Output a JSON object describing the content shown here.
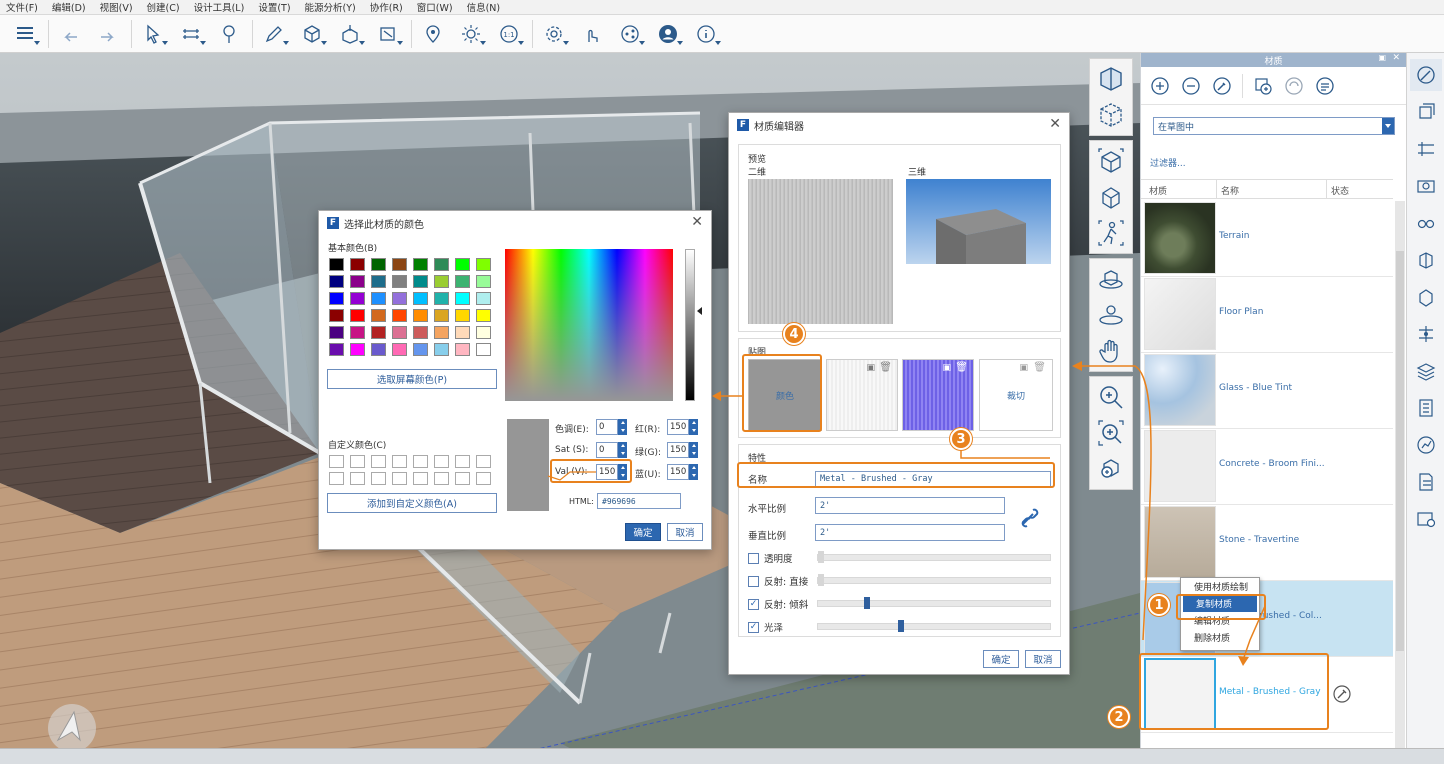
{
  "menu": [
    "文件(F)",
    "编辑(D)",
    "视图(V)",
    "创建(C)",
    "设计工具(L)",
    "设置(T)",
    "能源分析(Y)",
    "协作(R)",
    "窗口(W)",
    "信息(N)"
  ],
  "toolbar_icons": [
    "layers-icon",
    "undo-icon",
    "redo-icon",
    "select-icon",
    "measure-icon",
    "probe-icon",
    "draw-icon",
    "box-icon",
    "push-pull-icon",
    "transform-icon",
    "location-icon",
    "sun-icon",
    "scale-icon",
    "settings-icon",
    "touch-icon",
    "share-icon",
    "account-icon",
    "info-icon"
  ],
  "color_dialog": {
    "title": "选择此材质的颜色",
    "basic_label": "基本颜色(B)",
    "screen_pick_btn": "选取屏幕颜色(P)",
    "custom_label": "自定义颜色(C)",
    "add_custom_btn": "添加到自定义颜色(A)",
    "hue_label": "色调(E):",
    "hue": "0",
    "sat_label": "Sat (S):",
    "sat": "0",
    "val_label": "Val (V):",
    "val": "150",
    "red_label": "红(R):",
    "red": "150",
    "green_label": "绿(G):",
    "green": "150",
    "blue_label": "蓝(U):",
    "blue": "150",
    "html_label": "HTML:",
    "html": "#969696",
    "ok": "确定",
    "cancel": "取消",
    "basic_colors": [
      "#000000",
      "#8b0000",
      "#006400",
      "#8b4513",
      "#008000",
      "#2e8b57",
      "#00ff00",
      "#7fff00",
      "#000080",
      "#8b008b",
      "#1e6d8b",
      "#808080",
      "#008b8b",
      "#9acd32",
      "#3cb371",
      "#98fb98",
      "#0000ff",
      "#9400d3",
      "#1e90ff",
      "#9370db",
      "#00bfff",
      "#20b2aa",
      "#00ffff",
      "#afeeee",
      "#8b0000",
      "#ff0000",
      "#d2691e",
      "#ff4500",
      "#ff8c00",
      "#daa520",
      "#ffd700",
      "#ffff00",
      "#4b0082",
      "#c71585",
      "#b22222",
      "#db7093",
      "#cd5c5c",
      "#f4a460",
      "#ffdab9",
      "#ffffe0",
      "#6a0dad",
      "#ff00ff",
      "#6a5acd",
      "#ff69b4",
      "#6495ed",
      "#87ceeb",
      "#ffb6c1",
      "#ffffff"
    ]
  },
  "material_editor": {
    "title": "材质编辑器",
    "preview_label": "预览",
    "preview_2d": "二维",
    "preview_3d": "三维",
    "maps_label": "贴图",
    "map_color": "颜色",
    "map_cut": "裁切",
    "props_label": "特性",
    "name_label": "名称",
    "name_value": "Metal - Brushed - Gray",
    "hscale_label": "水平比例",
    "hscale": "2'",
    "vscale_label": "垂直比例",
    "vscale": "2'",
    "transparency": "透明度",
    "reflect_direct": "反射: 直接",
    "reflect_oblique": "反射: 倾斜",
    "gloss": "光泽",
    "ok": "确定",
    "cancel": "取消"
  },
  "materials_panel": {
    "title": "材质",
    "dropdown": "在草图中",
    "filter": "过滤器...",
    "col_material": "材质",
    "col_name": "名称",
    "col_state": "状态",
    "items": [
      {
        "name": "Terrain"
      },
      {
        "name": "Floor Plan"
      },
      {
        "name": "Glass - Blue Tint"
      },
      {
        "name": "Concrete - Broom Fini..."
      },
      {
        "name": "Stone - Travertine"
      },
      {
        "name": "Metal - Brushed - Col..."
      },
      {
        "name": "Metal - Brushed - Gray"
      }
    ]
  },
  "context_menu": [
    "使用材质绘制",
    "复制材质",
    "编辑材质",
    "删除材质"
  ],
  "annotations": [
    "1",
    "2",
    "3",
    "4"
  ],
  "accent": "#e8821e",
  "brand": "#2c67b0"
}
